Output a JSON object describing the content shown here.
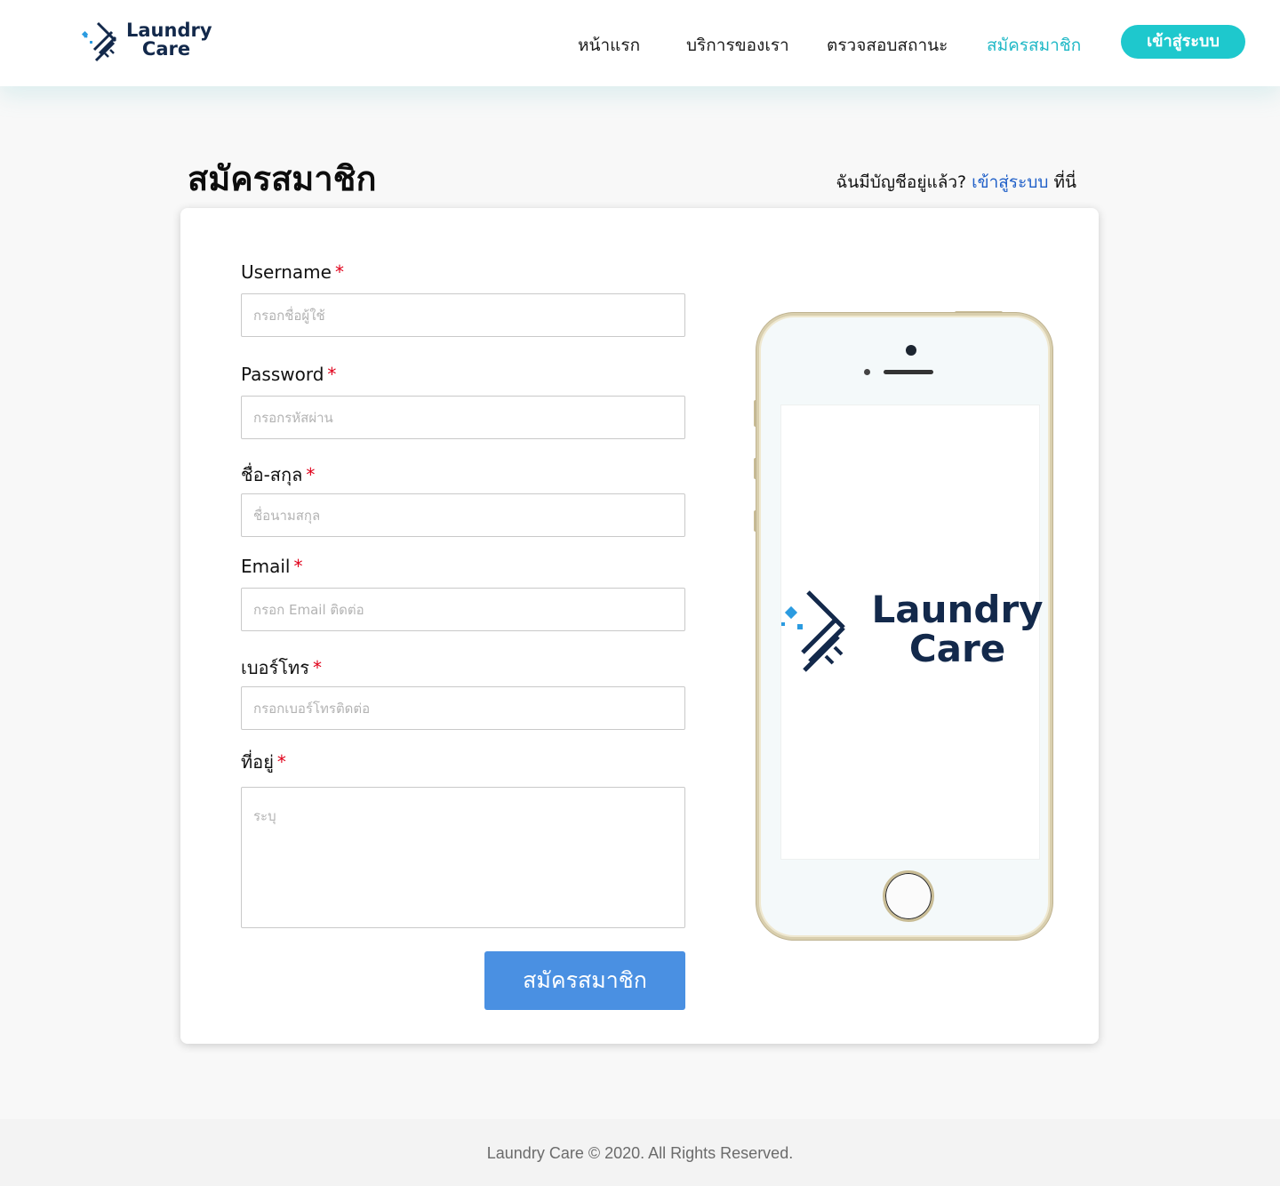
{
  "brand": {
    "line1": "Laundry",
    "line2": "Care"
  },
  "nav": {
    "items": [
      {
        "label": "หน้าแรก"
      },
      {
        "label": "บริการของเรา"
      },
      {
        "label": "ตรวจสอบสถานะ"
      },
      {
        "label": "สมัครสมาชิก",
        "active": true
      }
    ],
    "login_button": "เข้าสู่ระบบ"
  },
  "page": {
    "title": "สมัครสมาชิก",
    "have_account_prefix": "ฉันมีบัญชีอยู่แล้ว?",
    "have_account_link": "เข้าสู่ระบบ",
    "have_account_suffix": "ที่นี่"
  },
  "form": {
    "required_mark": "*",
    "fields": [
      {
        "label": "Username",
        "placeholder": "กรอกชื่อผู้ใช้",
        "value": ""
      },
      {
        "label": "Password",
        "placeholder": "กรอกรหัสผ่าน",
        "value": ""
      },
      {
        "label": "ชื่อ-สกุล",
        "placeholder": "ชื่อนามสกุล",
        "value": ""
      },
      {
        "label": "Email",
        "placeholder": "กรอก Email ติดต่อ",
        "value": ""
      },
      {
        "label": "เบอร์โทร",
        "placeholder": "กรอกเบอร์โทรติดต่อ",
        "value": ""
      },
      {
        "label": "ที่อยู่",
        "placeholder": "ระบุ",
        "value": ""
      }
    ],
    "submit_label": "สมัครสมาชิก"
  },
  "phone_screen": {
    "line1": "Laundry",
    "line2": "Care"
  },
  "footer": {
    "text": "Laundry Care © 2020. All Rights Reserved."
  },
  "colors": {
    "accent": "#1ec8cd",
    "active_nav": "#1fb8c6",
    "link": "#1f5fc8",
    "submit": "#4a90e2",
    "required": "#e0001a",
    "brand_navy": "#13294b"
  },
  "icons": [
    "laundry-logo-icon",
    "sparkle-icon",
    "iron-icon"
  ]
}
